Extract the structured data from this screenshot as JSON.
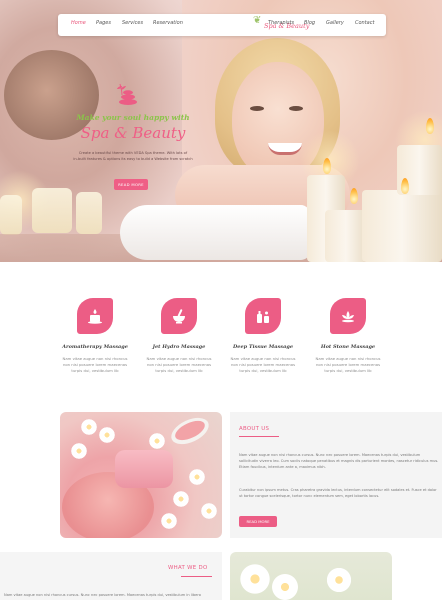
{
  "brand": {
    "accent": "#ec5d85",
    "green": "#8bc44a",
    "logo_text": "Spa & Beauty"
  },
  "nav": {
    "items": [
      "Home",
      "Pages",
      "Services",
      "Reservation",
      "Therapists",
      "Blog",
      "Gallery",
      "Contact"
    ],
    "active": "Home"
  },
  "hero": {
    "icon": "lotus-stones-icon",
    "tagline": "Make your soul happy with",
    "brand": "Spa & Beauty",
    "sub_line1": "Create a beautiful theme with VEDA Spa theme. With lots of",
    "sub_line2": "in-built features & options its easy to build a Website from scratch",
    "button": "READ MORE"
  },
  "services": [
    {
      "title": "Aromatherapy Massage",
      "icon": "candle-icon",
      "desc1": "Nam vitae augue non nisi rhoncus",
      "desc2": "non nisi posuere lorem maecenas",
      "desc3": "turpis dui, vestibulum lib"
    },
    {
      "title": "Jet Hydro Massage",
      "icon": "mortar-pestle-icon",
      "desc1": "Nam vitae augue non nisi rhoncus",
      "desc2": "non nisi posuere lorem maecenas",
      "desc3": "turpis dui, vestibulum lib"
    },
    {
      "title": "Deep Tissue Massage",
      "icon": "bottles-icon",
      "desc1": "Nam vitae augue non nisi rhoncus",
      "desc2": "non nisi posuere lorem maecenas",
      "desc3": "turpis dui, vestibulum lib"
    },
    {
      "title": "Hot Stone Massage",
      "icon": "lotus-icon",
      "desc1": "Nam vitae augue non nisi rhoncus",
      "desc2": "non nisi posuere lorem maecenas",
      "desc3": "turpis dui, vestibulum lib"
    }
  ],
  "about": {
    "title": "ABOUT US",
    "p1": "Nam vitae augue non nisi rhoncus cursus. Nunc nec posuere lorem. Maecenas turpis dui, vestibulum sollicitudin viverra leo. Cum sociis natoque penatibus et magnis dis parturient montes, nascetur ridiculus mus. Etiam faucibus, interdum ante a, maximus nibh.",
    "p2": "Curabitur non ipsum metus. Cras pharetra gravida lectus, interdum consectetur elit sodales et. Fusce et dolor ut tortor congue scelerisque, tortor nunc elementum sem, eget lobortis lacus.",
    "button": "READ MORE"
  },
  "what_we_do": {
    "title": "WHAT WE DO",
    "p1": "Nam vitae augue non nisi rhoncus cursus. Nunc nec posuere lorem. Maecenas turpis dui, vestibulum in libero"
  }
}
